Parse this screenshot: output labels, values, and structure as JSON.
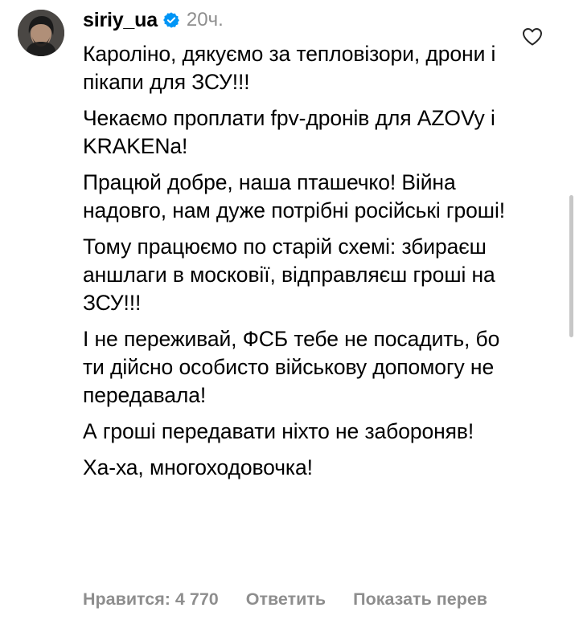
{
  "comment": {
    "username": "siriy_ua",
    "time": "20ч.",
    "paragraphs": [
      "Кароліно, дякуємо за тепловізори, дрони і пікапи для ЗСУ!!!",
      "Чекаємо проплати fpv-дронів для AZOVy і KRAKENa!",
      "Працюй добре, наша пташечко! Війна надовго, нам дуже потрібні російські гроші!",
      "Тому працюємо по старій схемі: збираєш аншлаги в московії, відправляєш гроші на ЗСУ!!!",
      "І не переживай, ФСБ тебе не посадить, бо ти дійсно особисто військову допомогу не передавала!",
      "А гроші передавати ніхто не забороняв!",
      "Ха-ха, многоходовочка!"
    ],
    "actions": {
      "likes": "Нравится: 4 770",
      "reply": "Ответить",
      "translate": "Показать перев"
    },
    "icons": {
      "verified": "verified-badge-icon",
      "like": "heart-icon",
      "avatar": "avatar"
    },
    "colors": {
      "verified": "#0095f6",
      "muted": "#8e8e8e"
    }
  }
}
